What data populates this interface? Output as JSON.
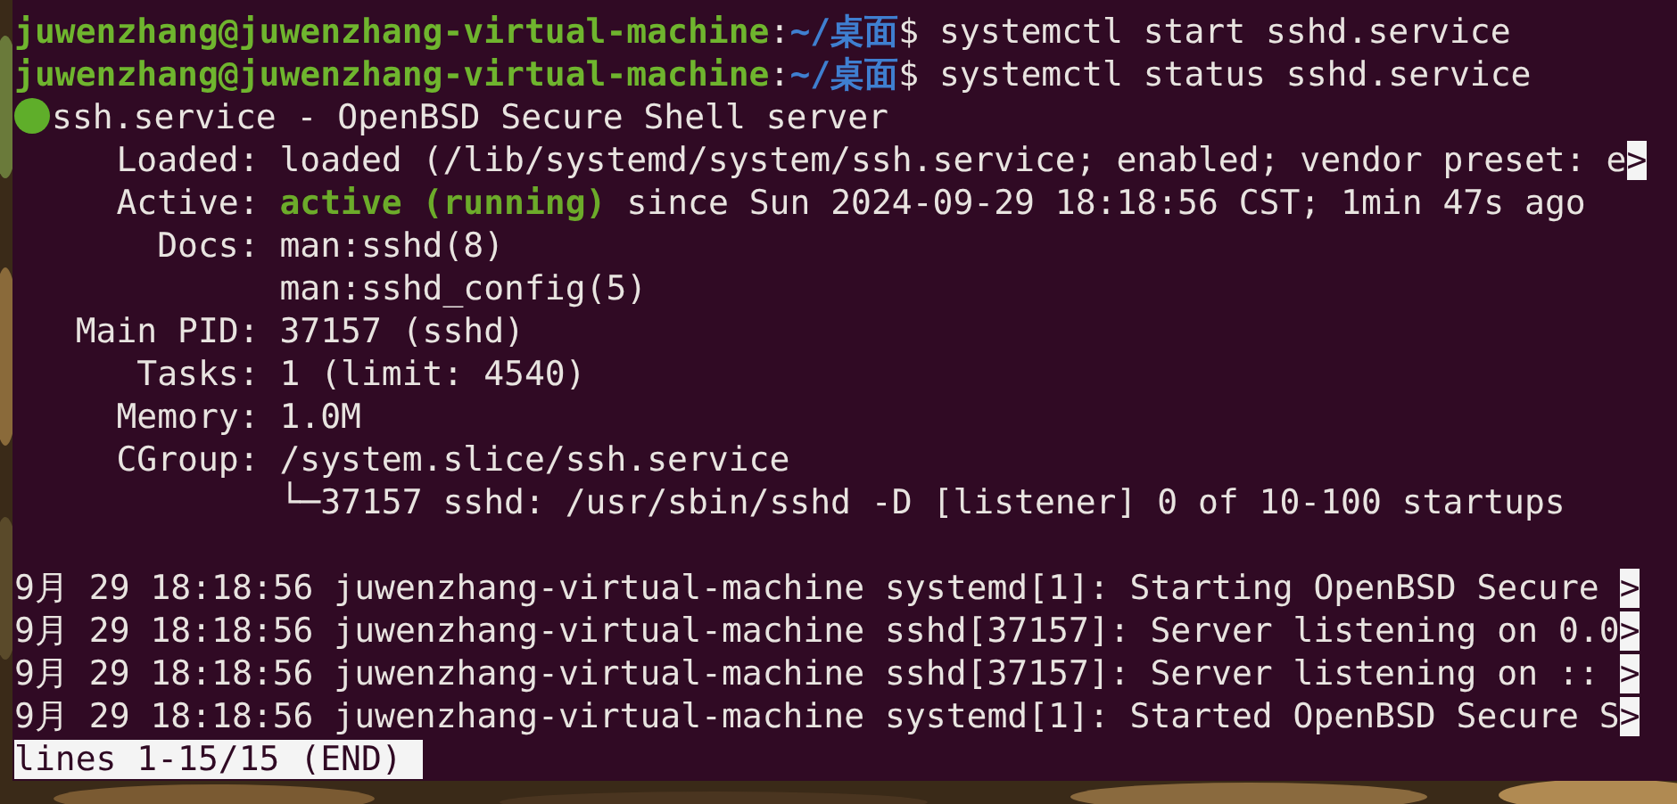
{
  "terminal": {
    "lines": [
      {
        "kind": "text",
        "segments": [
          {
            "kind": "user",
            "text": "juwenzhang@juwenzhang-virtual-machine"
          },
          {
            "kind": "plain",
            "text": ":"
          },
          {
            "kind": "path",
            "text": "~/桌面"
          },
          {
            "kind": "plain",
            "text": "$ systemctl start sshd.service"
          }
        ]
      },
      {
        "kind": "text",
        "segments": [
          {
            "kind": "user",
            "text": "juwenzhang@juwenzhang-virtual-machine"
          },
          {
            "kind": "plain",
            "text": ":"
          },
          {
            "kind": "path",
            "text": "~/桌面"
          },
          {
            "kind": "plain",
            "text": "$ systemctl status sshd.service"
          }
        ]
      },
      {
        "kind": "text",
        "segments": [
          {
            "kind": "dot"
          },
          {
            "kind": "plain",
            "text": "ssh.service - OpenBSD Secure Shell server"
          }
        ]
      },
      {
        "kind": "text",
        "segments": [
          {
            "kind": "plain",
            "text": "     Loaded: loaded (/lib/systemd/system/ssh.service; enabled; vendor preset: e"
          },
          {
            "kind": "marker",
            "text": ">"
          }
        ]
      },
      {
        "kind": "text",
        "segments": [
          {
            "kind": "plain",
            "text": "     Active: "
          },
          {
            "kind": "ok",
            "text": "active (running)"
          },
          {
            "kind": "plain",
            "text": " since Sun 2024-09-29 18:18:56 CST; 1min 47s ago"
          }
        ]
      },
      {
        "kind": "text",
        "segments": [
          {
            "kind": "plain",
            "text": "       Docs: man:sshd(8)"
          }
        ]
      },
      {
        "kind": "text",
        "segments": [
          {
            "kind": "plain",
            "text": "             man:sshd_config(5)"
          }
        ]
      },
      {
        "kind": "text",
        "segments": [
          {
            "kind": "plain",
            "text": "   Main PID: 37157 (sshd)"
          }
        ]
      },
      {
        "kind": "text",
        "segments": [
          {
            "kind": "plain",
            "text": "      Tasks: 1 (limit: 4540)"
          }
        ]
      },
      {
        "kind": "text",
        "segments": [
          {
            "kind": "plain",
            "text": "     Memory: 1.0M"
          }
        ]
      },
      {
        "kind": "text",
        "segments": [
          {
            "kind": "plain",
            "text": "     CGroup: /system.slice/ssh.service"
          }
        ]
      },
      {
        "kind": "text",
        "segments": [
          {
            "kind": "plain",
            "text": "             └─37157 sshd: /usr/sbin/sshd -D [listener] 0 of 10-100 startups"
          }
        ]
      },
      {
        "kind": "blank"
      },
      {
        "kind": "text",
        "segments": [
          {
            "kind": "plain",
            "text": "9月 29 18:18:56 juwenzhang-virtual-machine systemd[1]: Starting OpenBSD Secure "
          },
          {
            "kind": "marker",
            "text": ">"
          }
        ]
      },
      {
        "kind": "text",
        "segments": [
          {
            "kind": "plain",
            "text": "9月 29 18:18:56 juwenzhang-virtual-machine sshd[37157]: Server listening on 0.0"
          },
          {
            "kind": "marker",
            "text": ">"
          }
        ]
      },
      {
        "kind": "text",
        "segments": [
          {
            "kind": "plain",
            "text": "9月 29 18:18:56 juwenzhang-virtual-machine sshd[37157]: Server listening on :: "
          },
          {
            "kind": "marker",
            "text": ">"
          }
        ]
      },
      {
        "kind": "text",
        "segments": [
          {
            "kind": "plain",
            "text": "9月 29 18:18:56 juwenzhang-virtual-machine systemd[1]: Started OpenBSD Secure S"
          },
          {
            "kind": "marker",
            "text": ">"
          }
        ]
      }
    ],
    "pager_status": "lines 1-15/15 (END)"
  }
}
